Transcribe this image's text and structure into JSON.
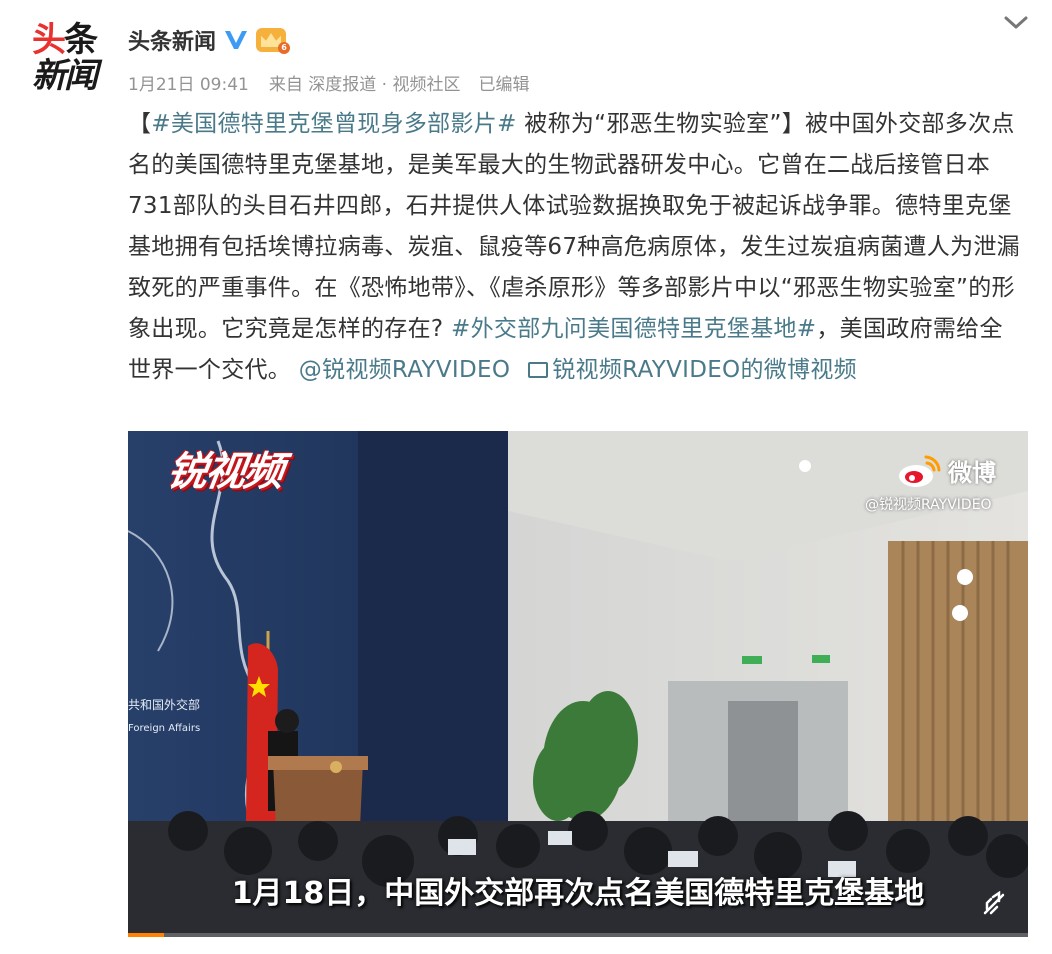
{
  "account": {
    "avatar_line1_red": "头",
    "avatar_line1_dark": "条",
    "avatar_line2": "新闻",
    "name": "头条新闻",
    "verified_icon": "blue-v-verified-icon",
    "member_icon": "crown-member-icon"
  },
  "post": {
    "date": "1月21日 09:41",
    "source": "来自 深度报道 · 视频社区",
    "edited": "已编辑",
    "content": {
      "bracket_open": "【",
      "hashtag1": "#美国德特里克堡曾现身多部影片#",
      "part1": " 被称为“邪恶生物实验室”】被中国外交部多次点名的美国德特里克堡基地，是美军最大的生物武器研发中心。它曾在二战后接管日本731部队的头目石井四郎，石井提供人体试验数据换取免于被起诉战争罪。德特里克堡基地拥有包括埃博拉病毒、炭疽、鼠疫等67种高危病原体，发生过炭疽病菌遭人为泄漏致死的严重事件。在《恐怖地带》、《虐杀原形》等多部影片中以“邪恶生物实验室”的形象出现。它究竟是怎样的存在? ",
      "hashtag2": "#外交部九问美国德特里克堡基地#",
      "part2": "，美国政府需给全世界一个交代。 ",
      "mention": "@锐视频RAYVIDEO",
      "video_link": "锐视频RAYVIDEO的微博视频"
    }
  },
  "video": {
    "watermark_logo": "锐视频",
    "weibo_label": "微博",
    "weibo_handle": "@锐视频RAYVIDEO",
    "subtitle": "1月18日，中国外交部再次点名美国德特里克堡基地",
    "backdrop_text1": "共和国外交部",
    "backdrop_text2": "Foreign Affairs",
    "progress": 0.04
  },
  "colors": {
    "link": "#4a7a8a",
    "brand_red": "#e8322f",
    "progress": "#ff8200"
  }
}
